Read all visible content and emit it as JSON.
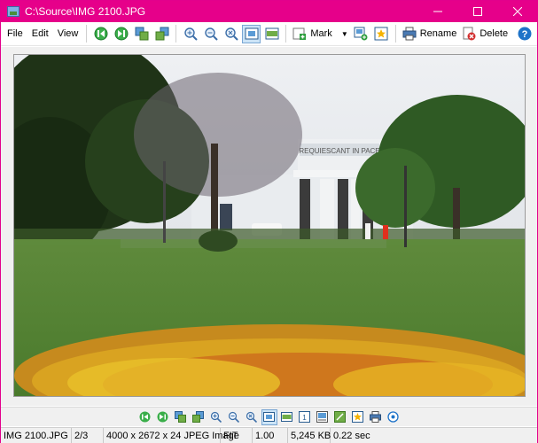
{
  "window": {
    "title": "C:\\Source\\IMG 2100.JPG"
  },
  "menu": [
    "File",
    "Edit",
    "View"
  ],
  "toolbar": {
    "mark_label": "Mark",
    "rename_label": "Rename",
    "delete_label": "Delete"
  },
  "status": {
    "filename": "IMG 2100.JPG",
    "position": "2/3",
    "info": "4000 x 2672 x 24 JPEG Image",
    "fit": "FIT",
    "zoom": "1.00",
    "size": "5,245 KB",
    "time": "0.22 sec"
  },
  "photo": {
    "sign_text": "REQUIESCANT IN PACE"
  },
  "colors": {
    "titlebar": "#e6008a",
    "accent": "#cce4f7",
    "nav_green": "#2e9e3e",
    "delete_red": "#d32f2f",
    "help_blue": "#1e73c8"
  }
}
